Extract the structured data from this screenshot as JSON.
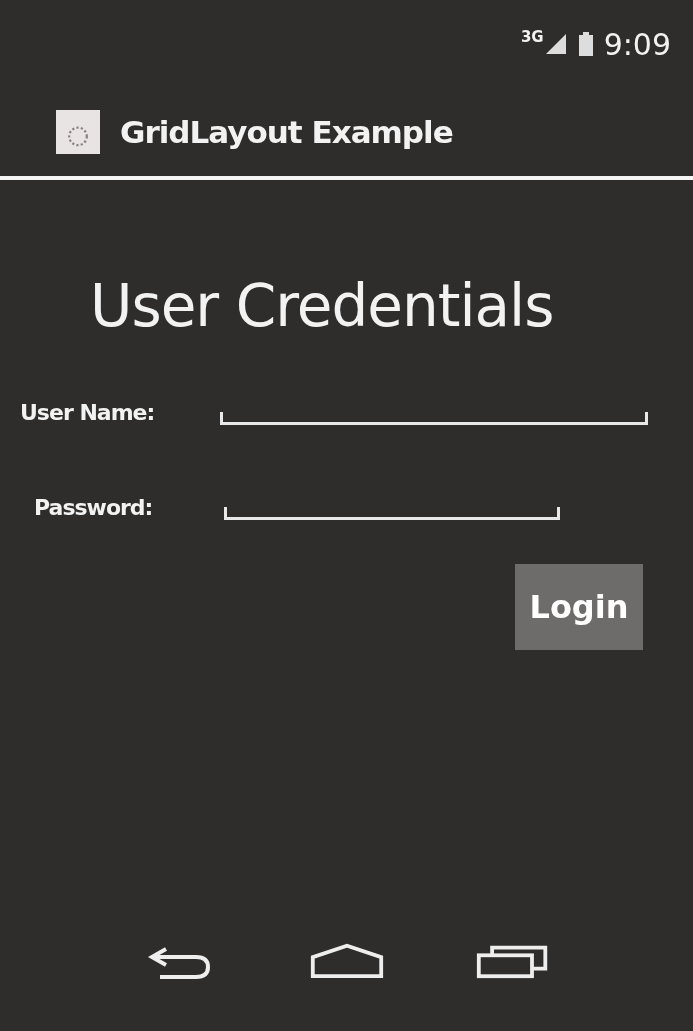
{
  "status_bar": {
    "network": "3G",
    "time": "9:09"
  },
  "action_bar": {
    "title": "GridLayout Example"
  },
  "form": {
    "heading": "User Credentials",
    "fields": [
      {
        "label": "User Name:"
      },
      {
        "label": "Password:"
      }
    ],
    "button": "Login"
  }
}
